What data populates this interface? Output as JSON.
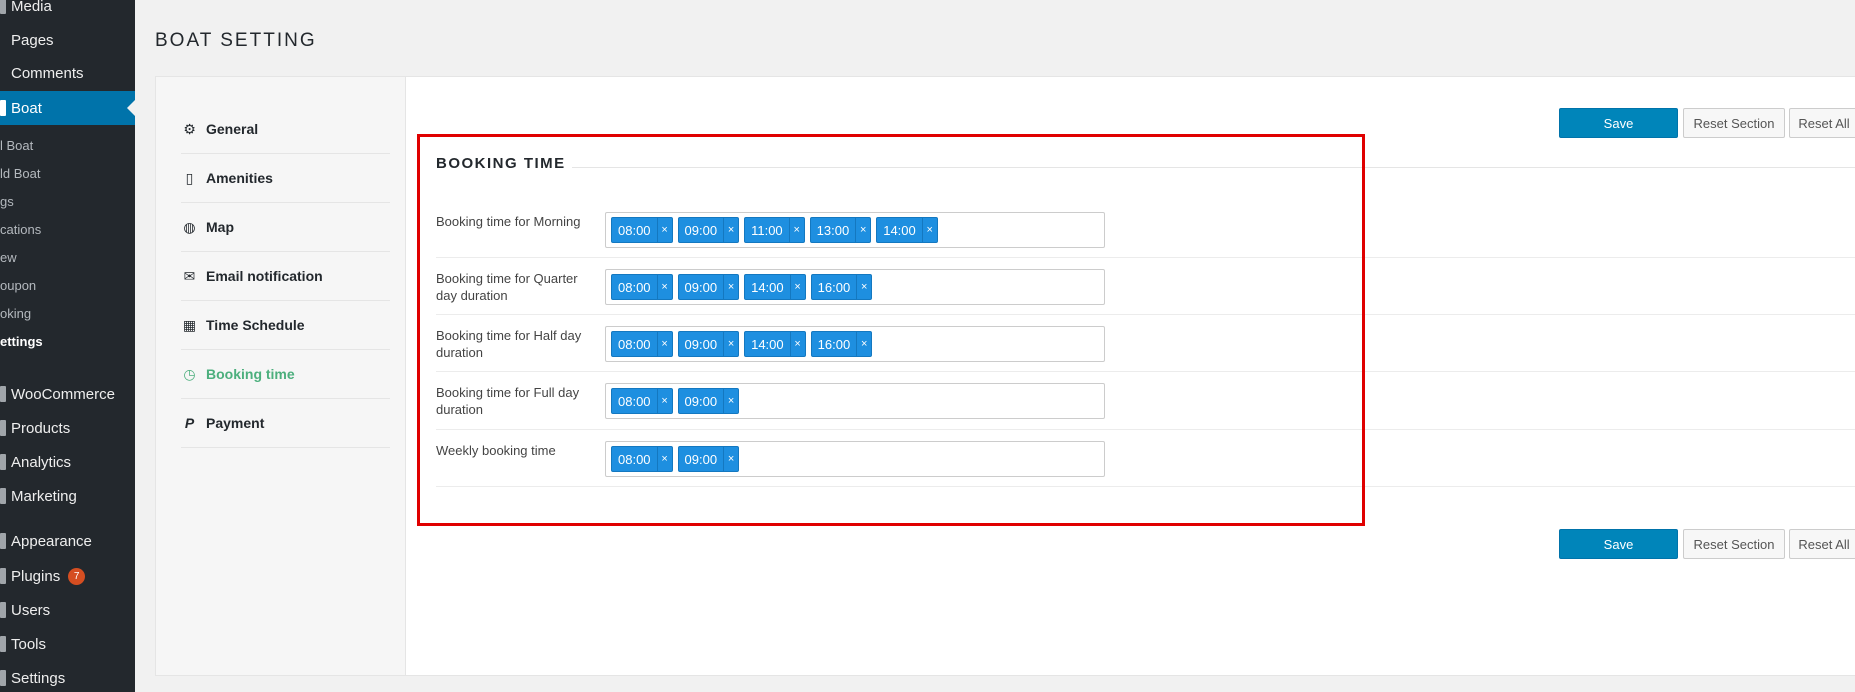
{
  "sidebar": {
    "items": [
      {
        "label": "Media"
      },
      {
        "label": "Pages"
      },
      {
        "label": "Comments"
      },
      {
        "label": "Boat"
      }
    ],
    "boat_submenu": [
      {
        "label": "l Boat"
      },
      {
        "label": "ld Boat"
      },
      {
        "label": "gs"
      },
      {
        "label": "cations"
      },
      {
        "label": "ew"
      },
      {
        "label": "oupon"
      },
      {
        "label": "oking"
      },
      {
        "label": "ettings"
      }
    ],
    "lower_items": [
      {
        "label": "WooCommerce"
      },
      {
        "label": "Products"
      },
      {
        "label": "Analytics"
      },
      {
        "label": "Marketing"
      },
      {
        "label": "Appearance"
      },
      {
        "label": "Plugins",
        "badge": "7"
      },
      {
        "label": "Users"
      },
      {
        "label": "Tools"
      },
      {
        "label": "Settings"
      }
    ]
  },
  "page": {
    "title": "BOAT SETTING"
  },
  "tabs": [
    {
      "label": "General",
      "icon": "gears-icon"
    },
    {
      "label": "Amenities",
      "icon": "building-icon"
    },
    {
      "label": "Map",
      "icon": "globe-icon"
    },
    {
      "label": "Email notification",
      "icon": "envelope-icon"
    },
    {
      "label": "Time Schedule",
      "icon": "calendar-icon"
    },
    {
      "label": "Booking time",
      "icon": "clock-icon"
    },
    {
      "label": "Payment",
      "icon": "paypal-icon"
    }
  ],
  "buttons": {
    "save": "Save",
    "reset_section": "Reset Section",
    "reset_all": "Reset All"
  },
  "section": {
    "title": "BOOKING TIME"
  },
  "fields": [
    {
      "label": "Booking time for Morning",
      "tags": [
        "08:00",
        "09:00",
        "11:00",
        "13:00",
        "14:00"
      ]
    },
    {
      "label": "Booking time for Quarter day duration",
      "tags": [
        "08:00",
        "09:00",
        "14:00",
        "16:00"
      ]
    },
    {
      "label": "Booking time for Half day duration",
      "tags": [
        "08:00",
        "09:00",
        "14:00",
        "16:00"
      ]
    },
    {
      "label": "Booking time for Full day duration",
      "tags": [
        "08:00",
        "09:00"
      ]
    },
    {
      "label": "Weekly booking time",
      "tags": [
        "08:00",
        "09:00"
      ]
    }
  ],
  "tag_remove_symbol": "×",
  "colors": {
    "accent": "#0085ba",
    "active_tab": "#4caf7d",
    "tag": "#1e8fe0",
    "highlight": "#e00000"
  }
}
